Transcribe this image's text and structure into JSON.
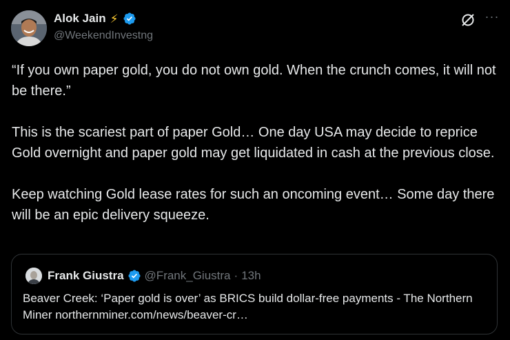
{
  "tweet": {
    "author_name": "Alok Jain",
    "author_emoji": "⚡",
    "author_handle": "@WeekendInvestng",
    "paragraphs": [
      "“If you own paper gold, you do not own gold. When the crunch comes, it will not be there.”",
      "This is the scariest part of paper Gold… One day USA may decide to reprice Gold overnight and paper gold may get liquidated in cash at the previous close.",
      "Keep watching Gold lease rates for such an oncoming event… Some day there will be an epic delivery squeeze."
    ],
    "more_label": "···"
  },
  "quoted": {
    "author_name": "Frank Giustra",
    "author_handle": "@Frank_Giustra",
    "separator": "·",
    "time": "13h",
    "text": "Beaver Creek: ‘Paper gold is over’ as BRICS build dollar-free payments - The Northern Miner northernminer.com/news/beaver-cr…"
  },
  "colors": {
    "background": "#000000",
    "text": "#e7e9ea",
    "secondary": "#71767b",
    "verified": "#1d9bf0",
    "border": "#2f3336"
  },
  "icons": {
    "verified": "verified-badge-icon",
    "grok": "grok-icon",
    "more": "more-options-icon"
  }
}
